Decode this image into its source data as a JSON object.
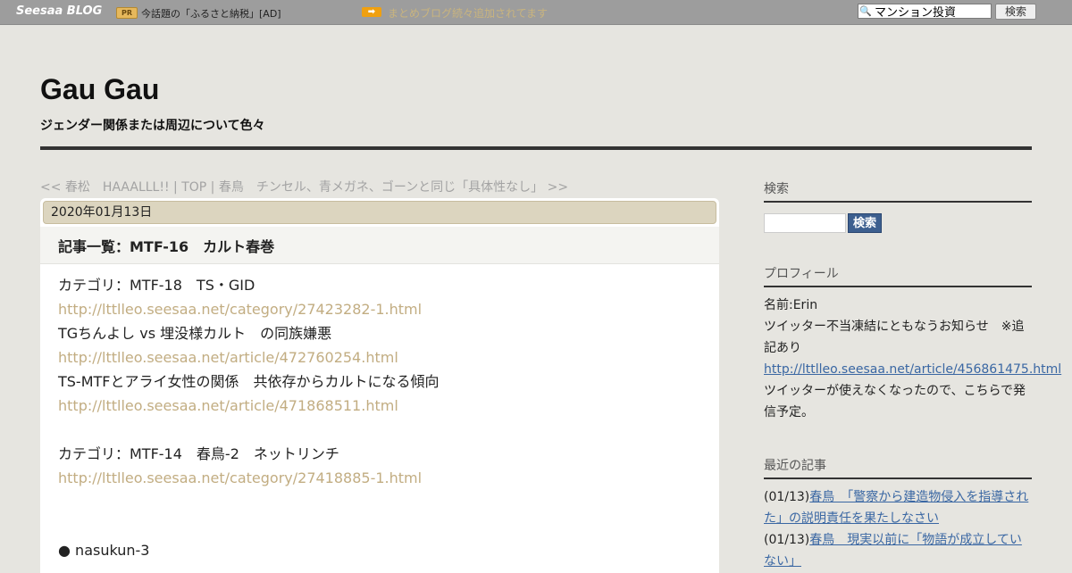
{
  "topbar": {
    "logo": "Seesaa BLOG",
    "pr_badge": "PR",
    "pr_text": "今話題の「ふるさと納税」[AD]",
    "arrow_badge": "➡",
    "arrow_text": "まとめブログ続々追加されてます",
    "search_value": "マンション投資",
    "search_button": "検索",
    "colors": {
      "bar": "#9d9d9d",
      "arrow_badge": "#f0a010"
    }
  },
  "header": {
    "title": "Gau Gau",
    "description": "ジェンダー関係または周辺について色々"
  },
  "pager": {
    "prev": "<< 春松　HAAALLL!!",
    "sep1": " | ",
    "top": "TOP",
    "sep2": " | ",
    "next": "春鳥　チンセル、青メガネ、ゴーンと同じ「具体性なし」 >>"
  },
  "post": {
    "date": "2020年01月13日",
    "title": "記事一覧：MTF-16　カルト春巻",
    "lines": [
      {
        "text": "カテゴリ：MTF-18　TS・GID",
        "kind": "text"
      },
      {
        "text": "http://lttlleo.seesaa.net/category/27423282-1.html",
        "kind": "link"
      },
      {
        "text": "TGちんよし vs 埋没様カルト　の同族嫌悪",
        "kind": "text"
      },
      {
        "text": "http://lttlleo.seesaa.net/article/472760254.html",
        "kind": "link"
      },
      {
        "text": "TS-MTFとアライ女性の関係　共依存からカルトになる傾向",
        "kind": "text"
      },
      {
        "text": "http://lttlleo.seesaa.net/article/471868511.html",
        "kind": "link"
      },
      {
        "text": "",
        "kind": "blank"
      },
      {
        "text": "カテゴリ：MTF-14　春鳥-2　ネットリンチ",
        "kind": "text"
      },
      {
        "text": "http://lttlleo.seesaa.net/category/27418885-1.html",
        "kind": "link"
      },
      {
        "text": "",
        "kind": "blank"
      },
      {
        "text": "",
        "kind": "blank"
      },
      {
        "text": "● nasukun-3",
        "kind": "text"
      }
    ],
    "link_color": "#c2ad82"
  },
  "sidebar": {
    "search": {
      "heading": "検索",
      "button": "検索"
    },
    "profile": {
      "heading": "プロフィール",
      "name_line": "名前:Erin",
      "notice": "ツイッター不当凍結にともなうお知らせ　※追記あり",
      "link": "http://lttlleo.seesaa.net/article/456861475.html",
      "after": "ツイッターが使えなくなったので、こちらで発信予定。"
    },
    "recent": {
      "heading": "最近の記事",
      "items": [
        {
          "date": "(01/13)",
          "title": "春鳥　「警察から建造物侵入を指導された」の説明責任を果たしなさい"
        },
        {
          "date": "(01/13)",
          "title": "春鳥　現実以前に「物語が成立していない」"
        }
      ]
    }
  }
}
